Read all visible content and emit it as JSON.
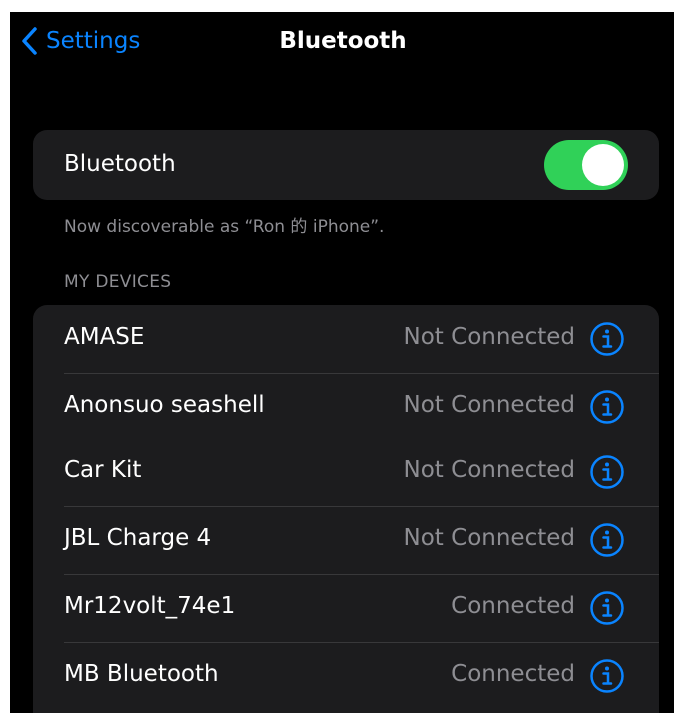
{
  "nav": {
    "back_label": "Settings",
    "title": "Bluetooth",
    "back_icon": "chevron-left-icon"
  },
  "bluetooth": {
    "label": "Bluetooth",
    "enabled": true,
    "discoverable_note": "Now discoverable as “Ron 的 iPhone”."
  },
  "my_devices": {
    "header": "MY DEVICES",
    "devices": [
      {
        "name": "AMASE",
        "status": "Not Connected"
      },
      {
        "name": "Anonsuo seashell",
        "status": "Not Connected"
      },
      {
        "name": "Car Kit",
        "status": "Not Connected"
      },
      {
        "name": "JBL Charge 4",
        "status": "Not Connected"
      },
      {
        "name": "Mr12volt_74e1",
        "status": "Connected"
      },
      {
        "name": "MB Bluetooth",
        "status": "Connected"
      }
    ]
  },
  "colors": {
    "accent": "#0a84ff",
    "toggle_on": "#30d158",
    "background": "#000000",
    "card": "#1c1c1e",
    "secondary_text": "#8e8e93"
  }
}
